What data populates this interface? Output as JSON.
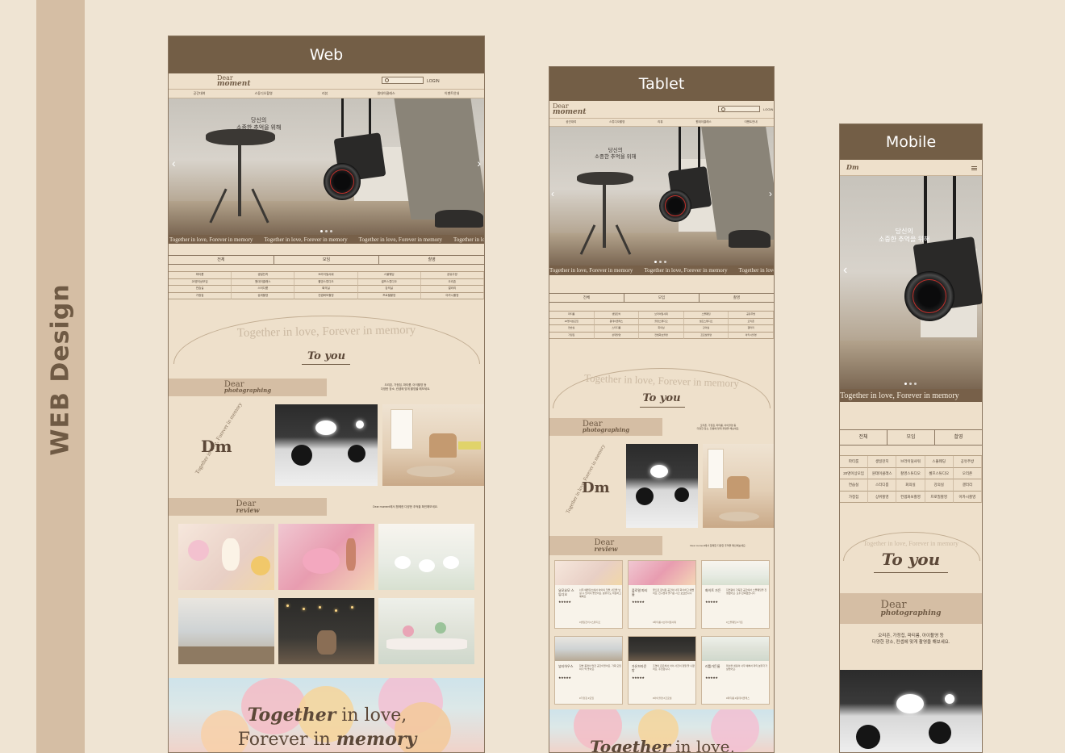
{
  "page": {
    "side_title": "WEB Design"
  },
  "frames": {
    "web": "Web",
    "tablet": "Tablet",
    "mobile": "Mobile"
  },
  "nav": {
    "logo_line1": "Dear",
    "logo_line2": "moment",
    "login": "LOGIN",
    "menu": [
      "공간대여",
      "스튜디오촬영",
      "리뷰",
      "원데이클래스",
      "이벤트안내"
    ]
  },
  "hero": {
    "headline_line1": "당신의",
    "headline_line2": "소중한 추억을 위해",
    "prev": "‹",
    "next": "›",
    "marquee": "Together in love, Forever in memory"
  },
  "categories": {
    "tabs": [
      "전체",
      "모임",
      "촬영"
    ],
    "grid": [
      "파티룸",
      "생일잔치",
      "브라이덜샤워",
      "스몰웨딩",
      "공유주방",
      "20명이상모임",
      "원데이클래스",
      "촬영스튜디오",
      "셀프스튜디오",
      "오리존",
      "연습실",
      "스터디룸",
      "회의실",
      "강의실",
      "갤러리",
      "가정집",
      "상위촬영",
      "컨셉화보촬영",
      "프로필촬영",
      "아카시촬영"
    ]
  },
  "arc": {
    "text": "Together in love, Forever in memory",
    "to_you": "To you"
  },
  "photographing": {
    "line1": "Dear",
    "line2": "photographing",
    "desc1": "오리존, 가정집, 파티룸, 아이촬영 등",
    "desc2": "다양한 장소, 컨셉에 맞게 촬영을 해보세요."
  },
  "dm": {
    "logo": "Dm",
    "circle_text": "Together in love, Forever in memory"
  },
  "review": {
    "line1": "Dear",
    "line2": "review",
    "desc": "Dear moment에서 함께한 다양한 추억을 확인해보세요.",
    "stars": "★★★★★",
    "cards": [
      {
        "title": "요모요모 스튜디오",
        "body": "너무 예쁜장소에서 아이의 첫돌 사진을 남길 수 있어서 좋았어요. 분위기도 따뜻하고 예뻐요.",
        "tag": "#생일잔치 #스튜디오"
      },
      {
        "title": "플로럴 파티룸",
        "body": "꽃으로 장식된 공간이 너무 화사하고 예뻤어요. 친구들과 즐거운 시간 보냈습니다.",
        "tag": "#파티룸 #브라이덜샤워"
      },
      {
        "title": "화이트 가든",
        "body": "자연광이 가득한 공간에서 스몰웨딩을 진행했어요. 모두 만족했습니다.",
        "tag": "#스몰웨딩 #가든"
      },
      {
        "title": "뷰티하우스",
        "body": "창밖 풍경이 멋진 공간이었어요. 가족 모임하기 딱 좋아요.",
        "tag": "#가정집 #모임"
      },
      {
        "title": "가온브라운방",
        "body": "조명이 은은해서 아이 사진이 정말 잘 나왔어요. 추천합니다.",
        "tag": "#아이촬영 #프로필"
      },
      {
        "title": "리틀가든룸",
        "body": "테이블 세팅이 너무 예뻐서 파티 분위기가 살았어요.",
        "tag": "#파티룸 #원데이클래스"
      }
    ]
  },
  "footer_banner": {
    "line1_italic": "Together",
    "line1_rest": " in love,",
    "line2_start": "Forever in ",
    "line2_italic": "memory"
  },
  "colors": {
    "background": "#efe4d3",
    "header": "#735e46",
    "band": "#d5bea4",
    "accent_text": "#6f5a44"
  }
}
